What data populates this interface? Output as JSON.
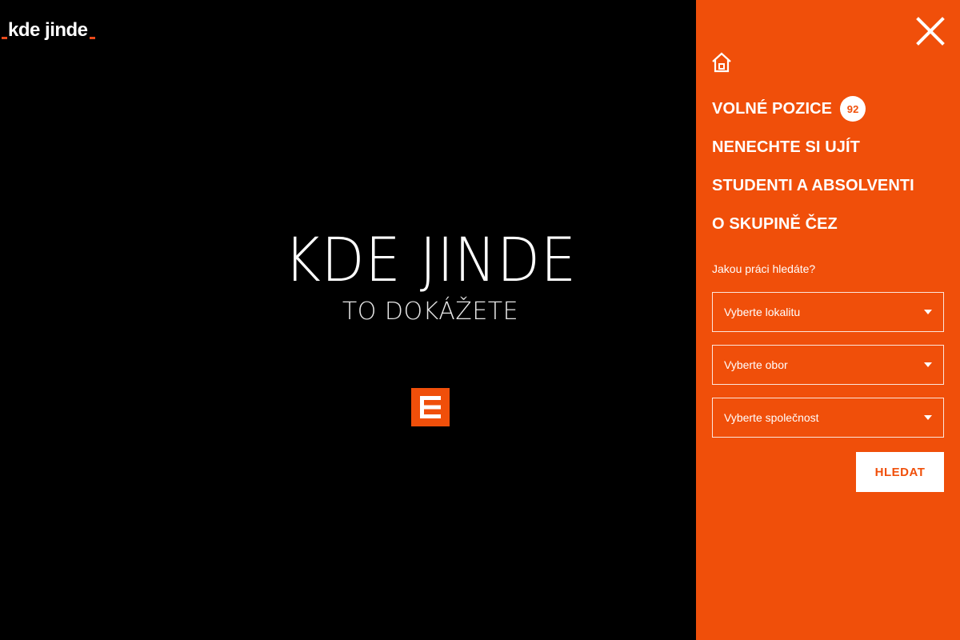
{
  "colors": {
    "background": "#000000",
    "accent": "#f04f0a",
    "text": "#ffffff"
  },
  "logo": {
    "text": "kde jinde"
  },
  "hero": {
    "title": "KDE JINDE",
    "subtitle": "TO DOKÁŽETE"
  },
  "icons": {
    "brand": "cez-logo-icon",
    "close": "close-icon",
    "home": "home-icon",
    "dropdown": "caret-down-icon"
  },
  "menu": {
    "items": [
      {
        "label": "VOLNÉ POZICE",
        "badge": "92"
      },
      {
        "label": "NENECHTE SI UJÍT"
      },
      {
        "label": "STUDENTI A ABSOLVENTI"
      },
      {
        "label": "O SKUPINĚ ČEZ"
      }
    ]
  },
  "search": {
    "label": "Jakou práci hledáte?",
    "location_placeholder": "Vyberte lokalitu",
    "field_placeholder": "Vyberte obor",
    "company_placeholder": "Vyberte společnost",
    "button_label": "HLEDAT"
  }
}
